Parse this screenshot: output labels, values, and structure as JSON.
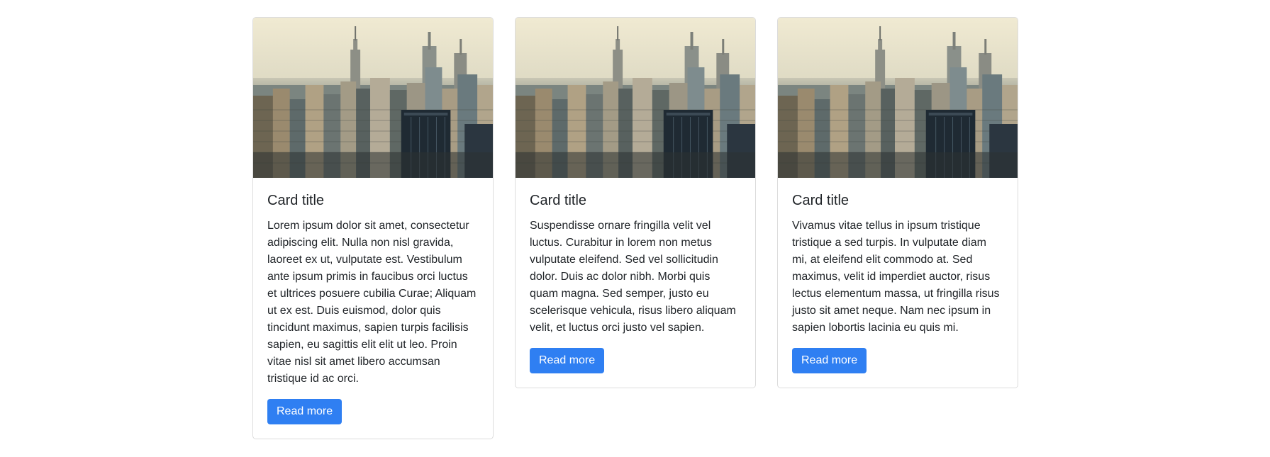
{
  "cards": [
    {
      "title": "Card title",
      "text": "Lorem ipsum dolor sit amet, consectetur adipiscing elit. Nulla non nisl gravida, laoreet ex ut, vulputate est. Vestibulum ante ipsum primis in faucibus orci luctus et ultrices posuere cubilia Curae; Aliquam ut ex est. Duis euismod, dolor quis tincidunt maximus, sapien turpis facilisis sapien, eu sagittis elit elit ut leo. Proin vitae nisl sit amet libero accumsan tristique id ac orci.",
      "button_label": "Read more"
    },
    {
      "title": "Card title",
      "text": "Suspendisse ornare fringilla velit vel luctus. Curabitur in lorem non metus vulputate eleifend. Sed vel sollicitudin dolor. Duis ac dolor nibh. Morbi quis quam magna. Sed semper, justo eu scelerisque vehicula, risus libero aliquam velit, et luctus orci justo vel sapien.",
      "button_label": "Read more"
    },
    {
      "title": "Card title",
      "text": "Vivamus vitae tellus in ipsum tristique tristique a sed turpis. In vulputate diam mi, at eleifend elit commodo at. Sed maximus, velit id imperdiet auctor, risus lectus elementum massa, ut fringilla risus justo sit amet neque. Nam nec ipsum in sapien lobortis lacinia eu quis mi.",
      "button_label": "Read more"
    }
  ],
  "colors": {
    "button": "#2f7ff2",
    "card_border": "#dcdcdc",
    "text": "#212529"
  }
}
